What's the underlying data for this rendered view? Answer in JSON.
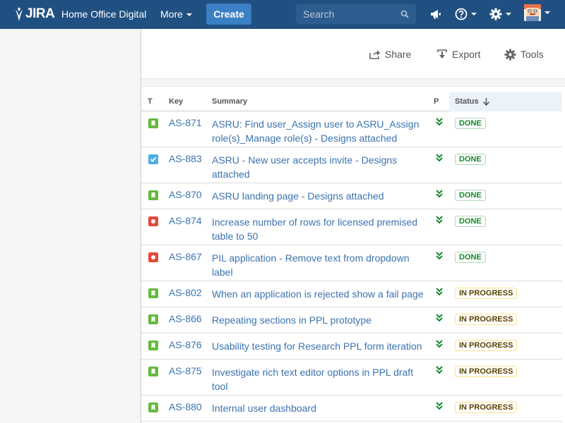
{
  "topbar": {
    "logo": "JIRA",
    "project": "Home Office Digital",
    "more": "More",
    "create": "Create",
    "search_placeholder": "Search"
  },
  "toolbar": {
    "share": "Share",
    "export": "Export",
    "tools": "Tools"
  },
  "table": {
    "headers": {
      "type": "T",
      "key": "Key",
      "summary": "Summary",
      "priority": "P",
      "status": "Status"
    },
    "rows": [
      {
        "type": "story",
        "key": "AS-871",
        "summary": "ASRU: Find user_Assign user to ASRU_Assign role(s)_Manage role(s) - Designs attached",
        "priority": "lowest",
        "status": "DONE"
      },
      {
        "type": "task",
        "key": "AS-883",
        "summary": "ASRU - New user accepts invite - Designs attached",
        "priority": "lowest",
        "status": "DONE"
      },
      {
        "type": "story",
        "key": "AS-870",
        "summary": "ASRU landing page - Designs attached",
        "priority": "lowest",
        "status": "DONE"
      },
      {
        "type": "bug",
        "key": "AS-874",
        "summary": "Increase number of rows for licensed premised table to 50",
        "priority": "lowest",
        "status": "DONE"
      },
      {
        "type": "bug",
        "key": "AS-867",
        "summary": "PIL application - Remove text from dropdown label",
        "priority": "lowest",
        "status": "DONE"
      },
      {
        "type": "story",
        "key": "AS-802",
        "summary": "When an application is rejected show a fail page",
        "priority": "lowest",
        "status": "IN PROGRESS"
      },
      {
        "type": "story",
        "key": "AS-866",
        "summary": "Repeating sections in PPL prototype",
        "priority": "lowest",
        "status": "IN PROGRESS"
      },
      {
        "type": "story",
        "key": "AS-876",
        "summary": "Usability testing for Research PPL form iteration",
        "priority": "lowest",
        "status": "IN PROGRESS"
      },
      {
        "type": "story",
        "key": "AS-875",
        "summary": "Investigate rich text editor options in PPL draft tool",
        "priority": "lowest",
        "status": "IN PROGRESS"
      },
      {
        "type": "story",
        "key": "AS-880",
        "summary": "Internal user dashboard",
        "priority": "lowest",
        "status": "IN PROGRESS"
      }
    ]
  },
  "colors": {
    "header_bg": "#205081",
    "create_btn": "#3b7fc4",
    "link": "#3b73af",
    "story": "#63ba3c",
    "task": "#4bade8",
    "bug": "#e5493a",
    "priority_lowest": "#14892c"
  }
}
